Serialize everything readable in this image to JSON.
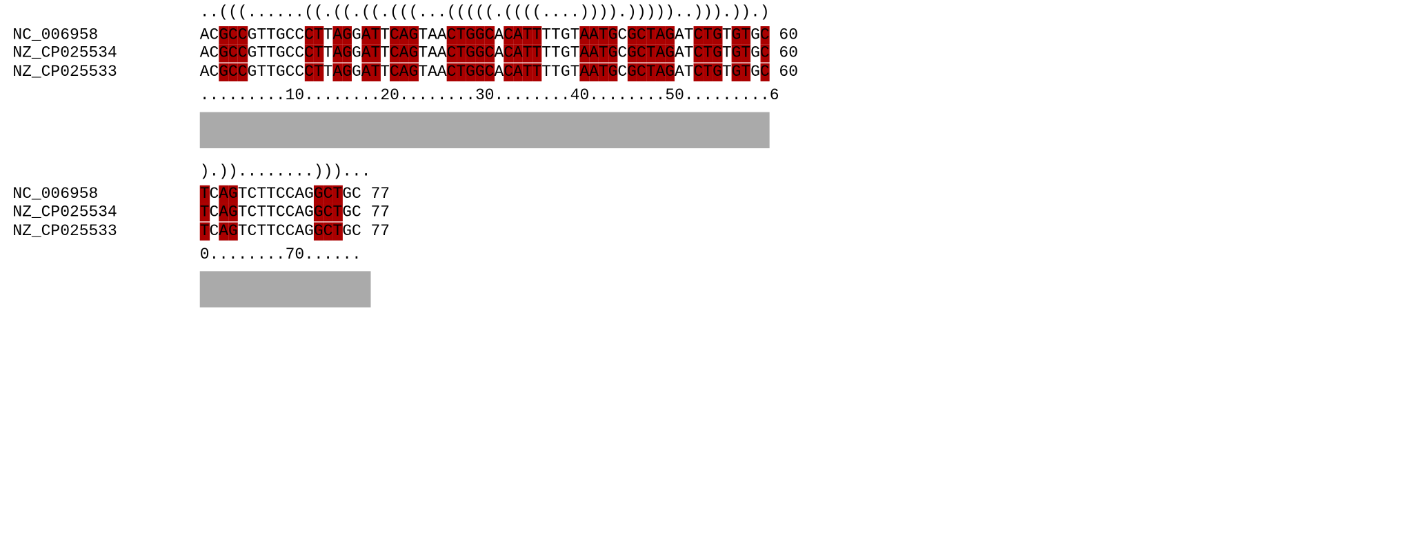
{
  "alignment": {
    "blocks": [
      {
        "structure": "..(((......((.((.((.(((...(((((.((((....)))).)))))..))).)).)",
        "sequences": [
          {
            "name": "NC_006958",
            "seq": "ACGCCGTTGCCCTTAGGATTCAGTAACTGGCACATTTTGTAATGCGCTAGATCTGTGTGC",
            "end": "60"
          },
          {
            "name": "NZ_CP025534",
            "seq": "ACGCCGTTGCCCTTAGGATTCAGTAACTGGCACATTTTGTAATGCGCTAGATCTGTGTGC",
            "end": "60"
          },
          {
            "name": "NZ_CP025533",
            "seq": "ACGCCGTTGCCCTTAGGATTCAGTAACTGGCACATTTTGTAATGCGCTAGATCTGTGTGC",
            "end": "60"
          }
        ],
        "ruler": ".........10........20........30........40........50.........6"
      },
      {
        "structure": ").))........)))...",
        "sequences": [
          {
            "name": "NC_006958",
            "seq": "TCAGTCTTCCAGGCTGC",
            "end": "77"
          },
          {
            "name": "NZ_CP025534",
            "seq": "TCAGTCTTCCAGGCTGC",
            "end": "77"
          },
          {
            "name": "NZ_CP025533",
            "seq": "TCAGTCTTCCAGGCTGC",
            "end": "77"
          }
        ],
        "ruler": "0........70......"
      }
    ],
    "colors": {
      "paired_highlight": "#aa0000",
      "conservation_bar": "#aaaaaa",
      "text": "#000000",
      "background": "#ffffff"
    }
  }
}
